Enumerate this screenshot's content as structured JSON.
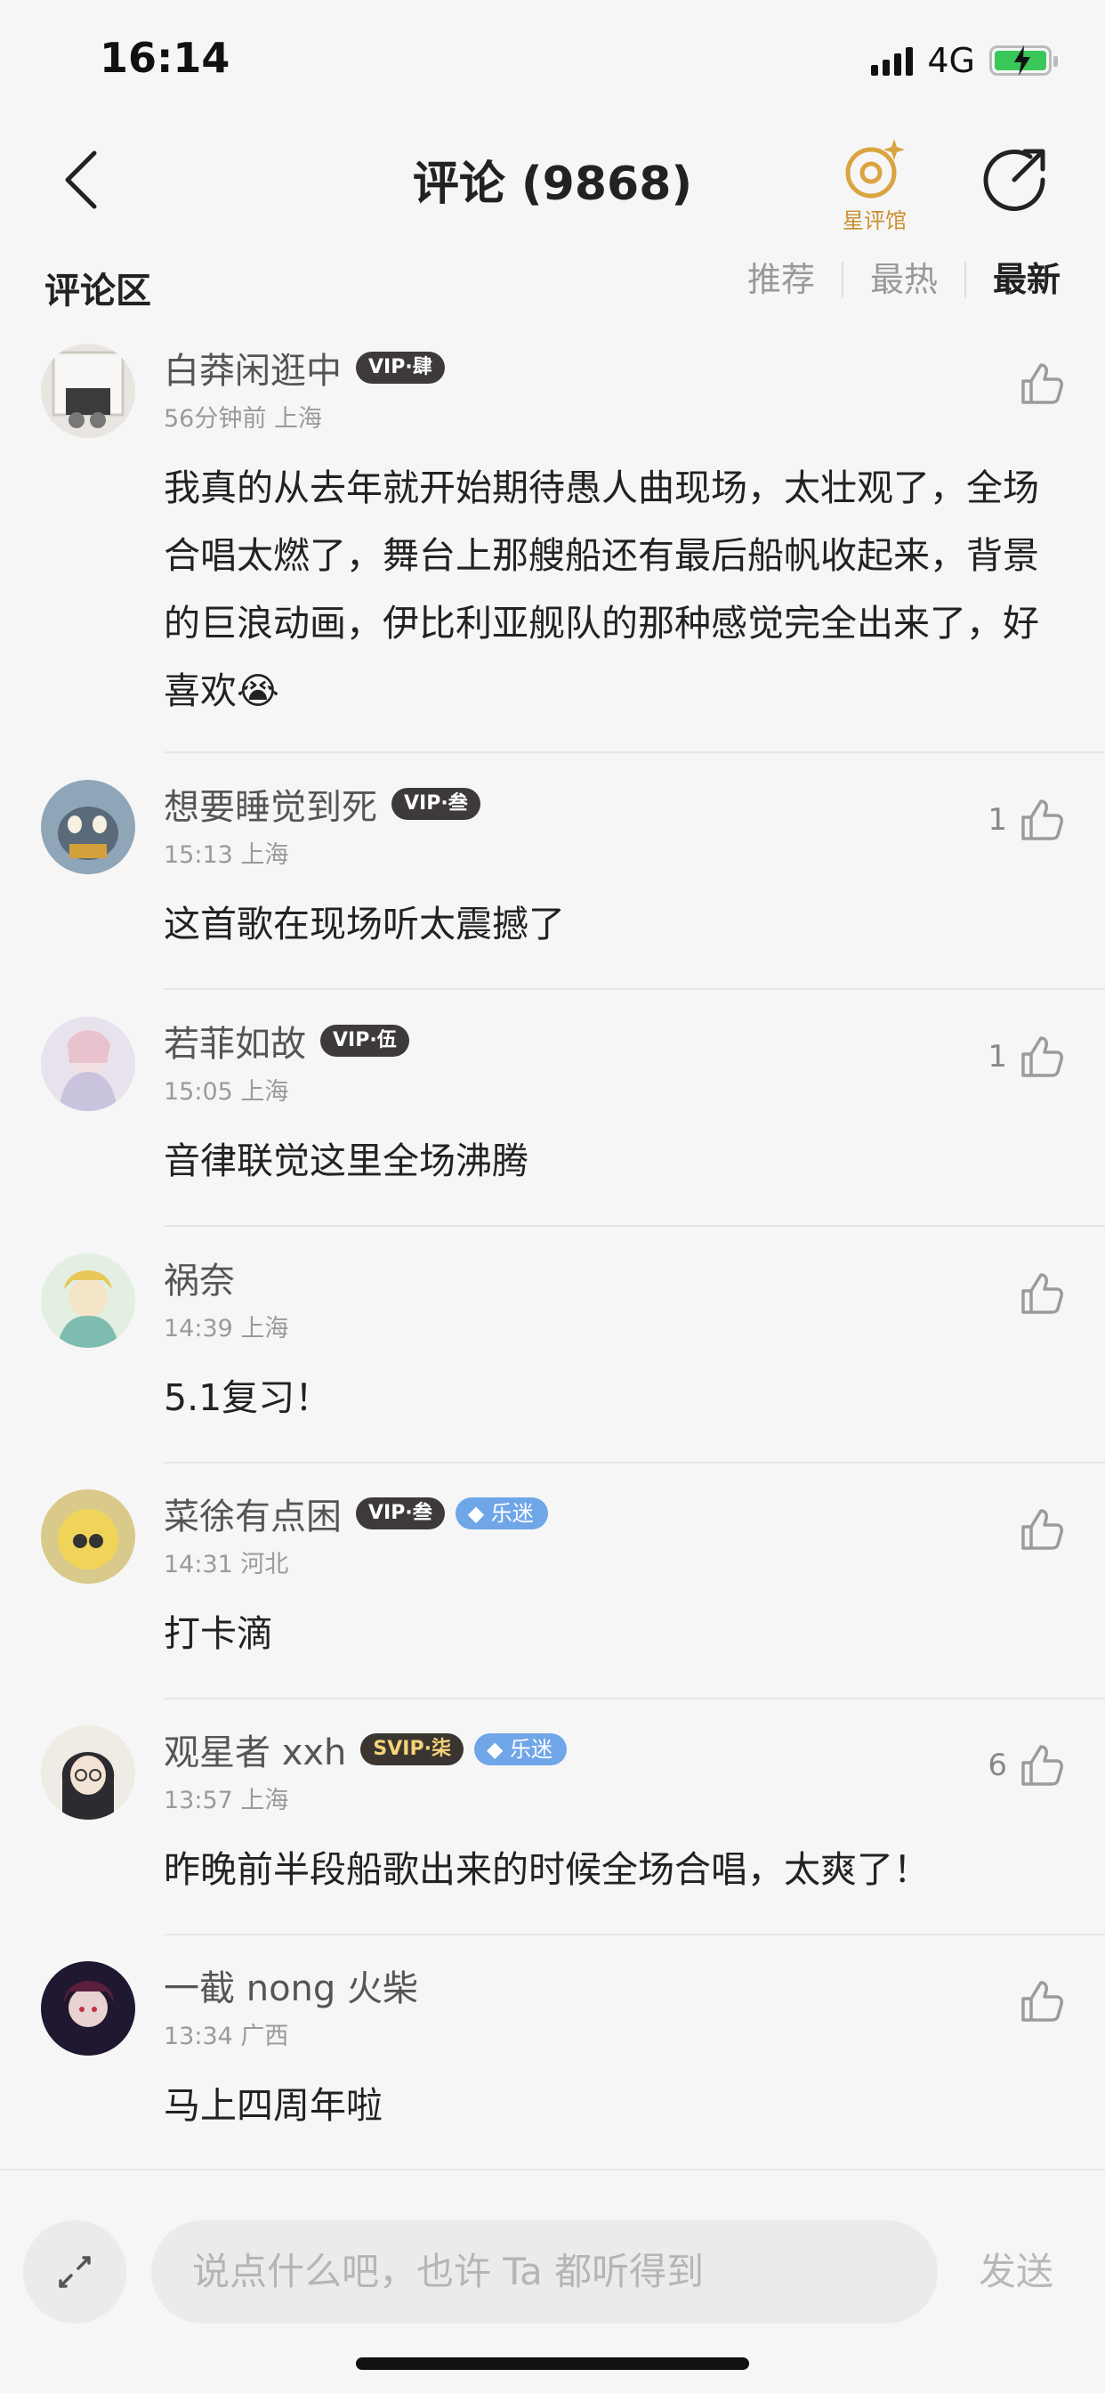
{
  "status": {
    "time": "16:14",
    "network": "4G"
  },
  "nav": {
    "title": "评论 (9868)",
    "star_label": "星评馆"
  },
  "section": {
    "title": "评论区",
    "tabs": [
      "推荐",
      "最热",
      "最新"
    ]
  },
  "comments": [
    {
      "name": "白莽闲逛中",
      "vip": "VIP·肆",
      "meta": "56分钟前 上海",
      "text": "我真的从去年就开始期待愚人曲现场，太壮观了，全场合唱太燃了，舞台上那艘船还有最后船帆收起来，背景的巨浪动画，伊比利亚舰队的那种感觉完全出来了，好喜欢😭",
      "likes": ""
    },
    {
      "name": "想要睡觉到死",
      "vip": "VIP·叁",
      "meta": "15:13 上海",
      "text": "这首歌在现场听太震撼了",
      "likes": "1"
    },
    {
      "name": "若菲如故",
      "vip": "VIP·伍",
      "meta": "15:05 上海",
      "text": "音律联觉这里全场沸腾",
      "likes": "1"
    },
    {
      "name": "祸奈",
      "meta": "14:39 上海",
      "text": "5.1复习！",
      "likes": ""
    },
    {
      "name": "菜徐有点困",
      "vip": "VIP·叁",
      "fan": "乐迷",
      "meta": "14:31 河北",
      "text": "打卡滴",
      "likes": ""
    },
    {
      "name": "观星者 xxh",
      "vip": "SVIP·柒",
      "fan": "乐迷",
      "meta": "13:57 上海",
      "text": "昨晚前半段船歌出来的时候全场合唱，太爽了！",
      "likes": "6"
    },
    {
      "name": "一截 nong 火柴",
      "meta": "13:34 广西",
      "text": "马上四周年啦",
      "likes": ""
    }
  ],
  "input": {
    "placeholder": "说点什么吧，也许 Ta 都听得到",
    "send_label": "发送"
  }
}
